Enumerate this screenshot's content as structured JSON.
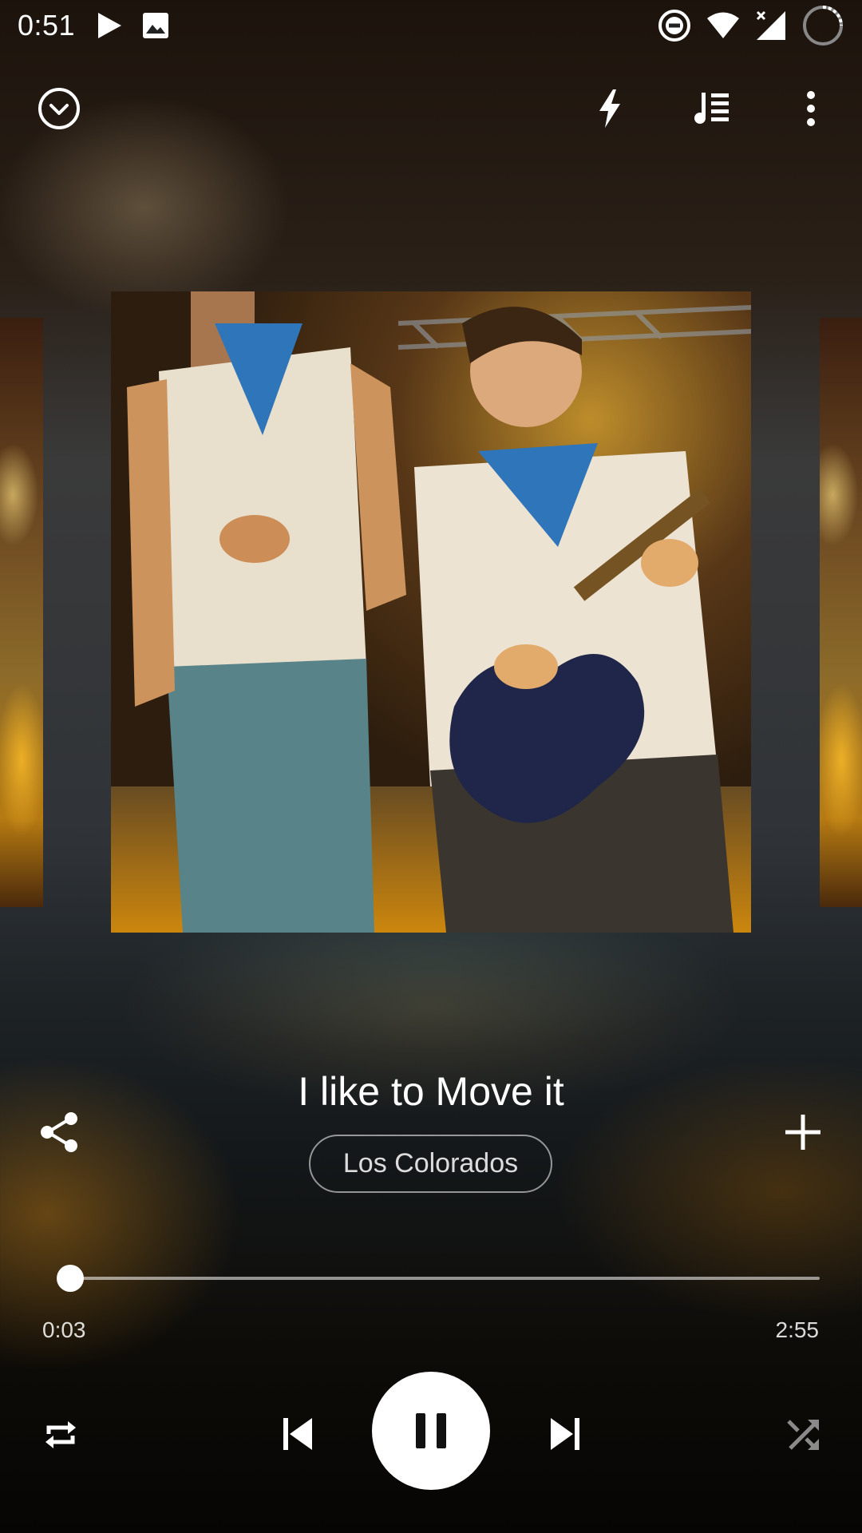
{
  "status_bar": {
    "time": "0:51",
    "icons": [
      "play-notification-icon",
      "image-notification-icon",
      "do-not-disturb-icon",
      "wifi-icon",
      "cellular-signal-icon",
      "battery-charging-icon"
    ]
  },
  "toolbar": {
    "icons": [
      "collapse-chevron-icon",
      "flash-icon",
      "queue-icon",
      "more-vertical-icon"
    ]
  },
  "track": {
    "title": "I like to Move it",
    "artist": "Los Colorados"
  },
  "playback": {
    "elapsed": "0:03",
    "duration": "2:55",
    "progress_fraction": 0.017,
    "state": "playing"
  },
  "controls": {
    "icons": [
      "share-icon",
      "add-icon",
      "repeat-icon",
      "skip-previous-icon",
      "pause-icon",
      "skip-next-icon",
      "shuffle-icon"
    ]
  },
  "colors": {
    "accent": "#ffffff",
    "play_button_bg": "#ffffff",
    "play_icon": "#111111",
    "shuffle_inactive": "#8a8a8a"
  }
}
